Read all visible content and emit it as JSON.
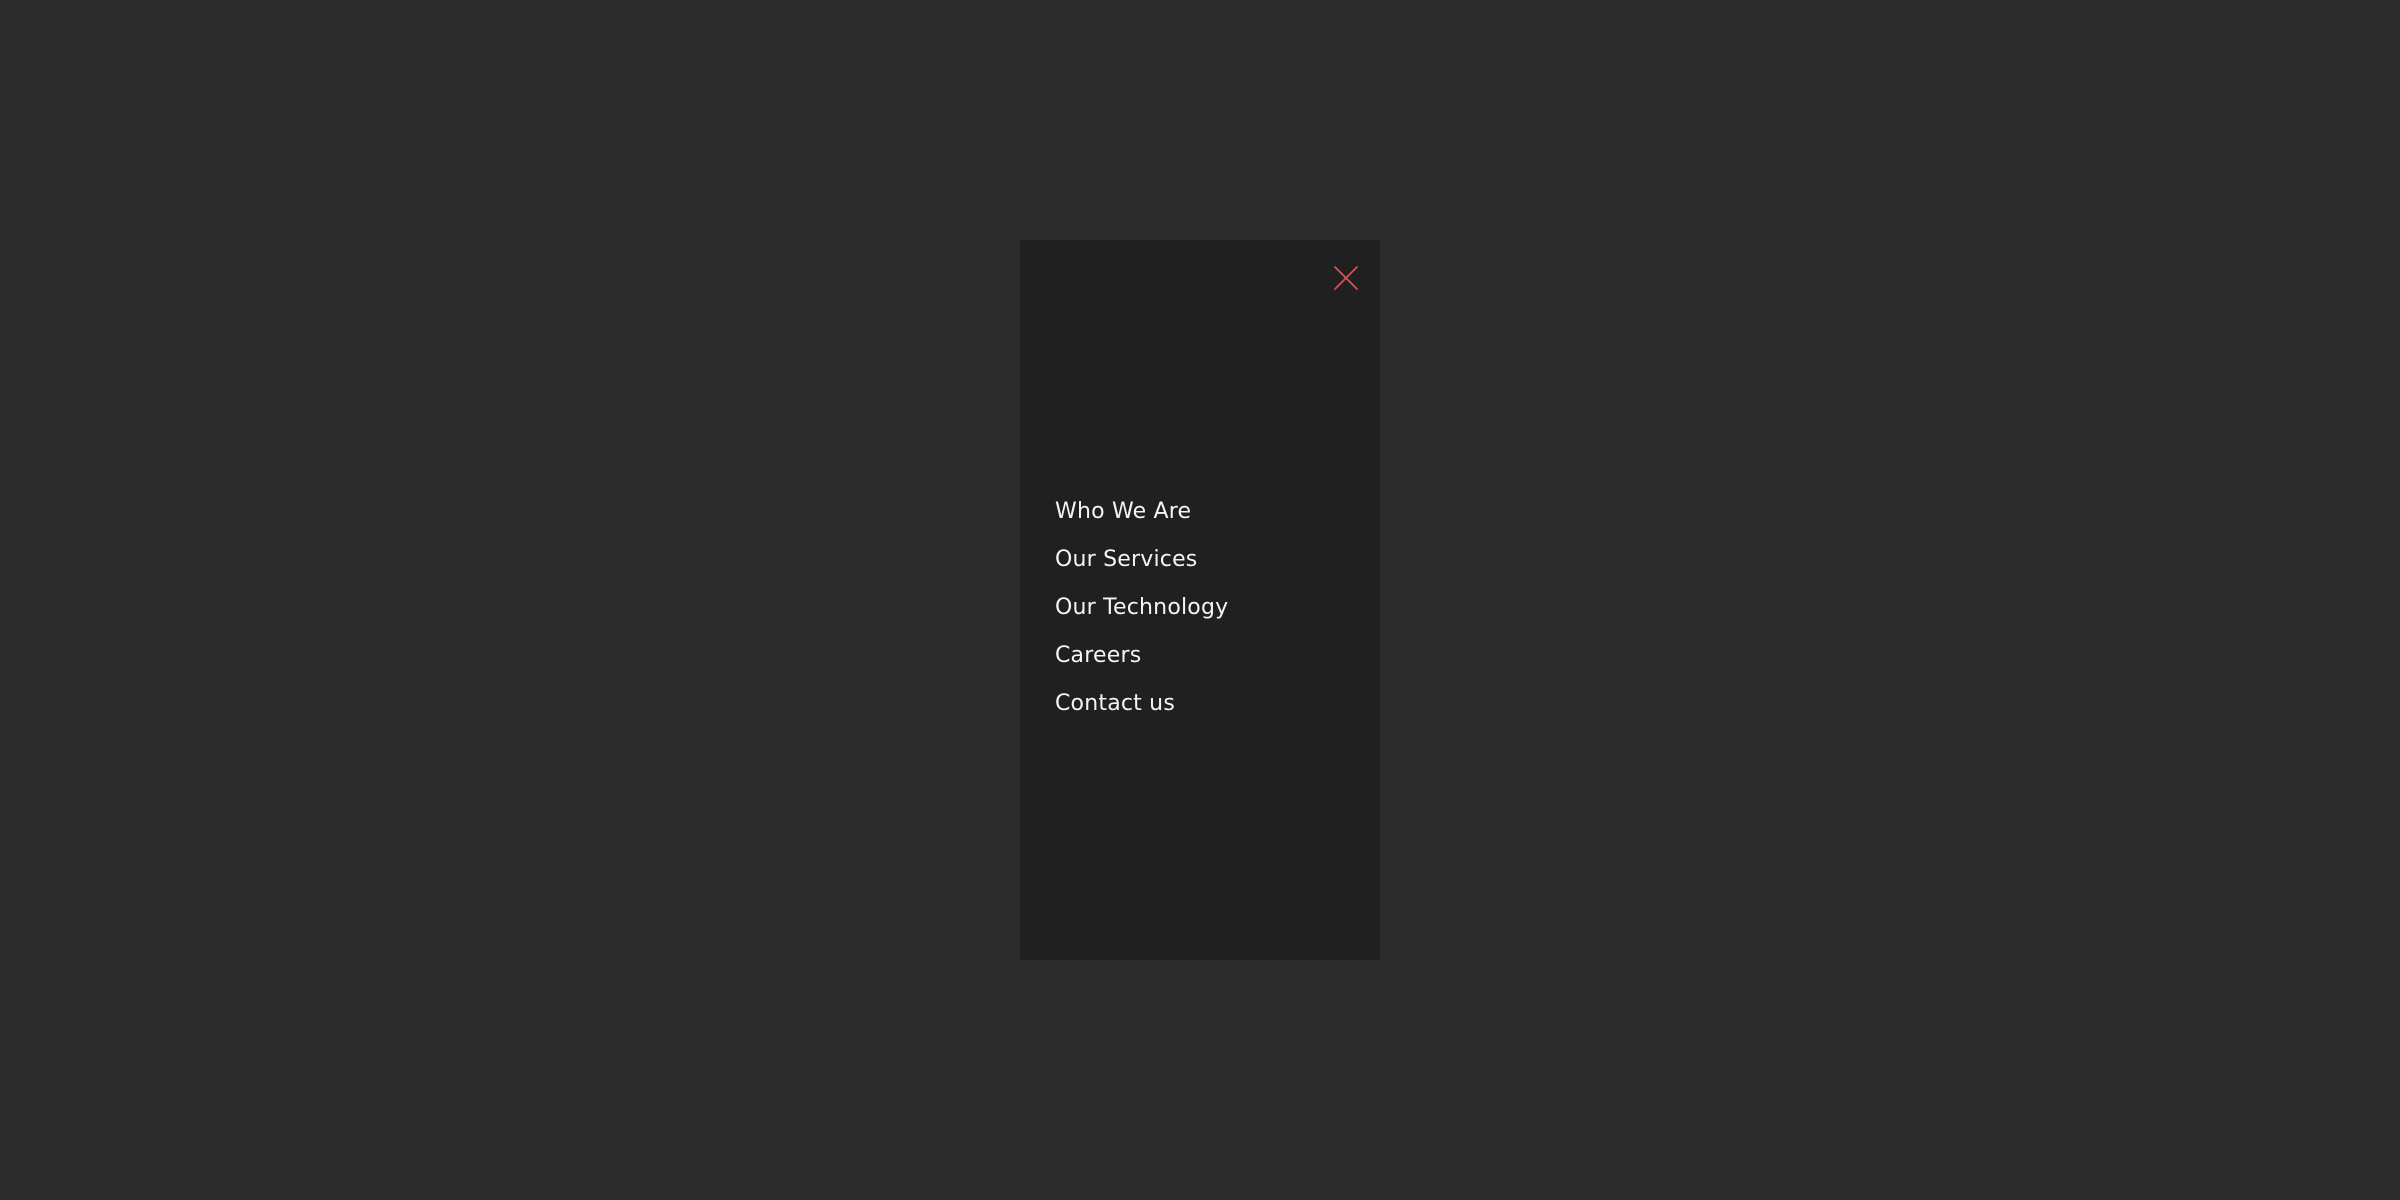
{
  "nav_panel": {
    "close_icon": "close-icon",
    "close_color": "#e45353",
    "items": [
      {
        "label": "Who We Are"
      },
      {
        "label": "Our Services"
      },
      {
        "label": "Our Technology"
      },
      {
        "label": "Careers"
      },
      {
        "label": "Contact us"
      }
    ]
  }
}
